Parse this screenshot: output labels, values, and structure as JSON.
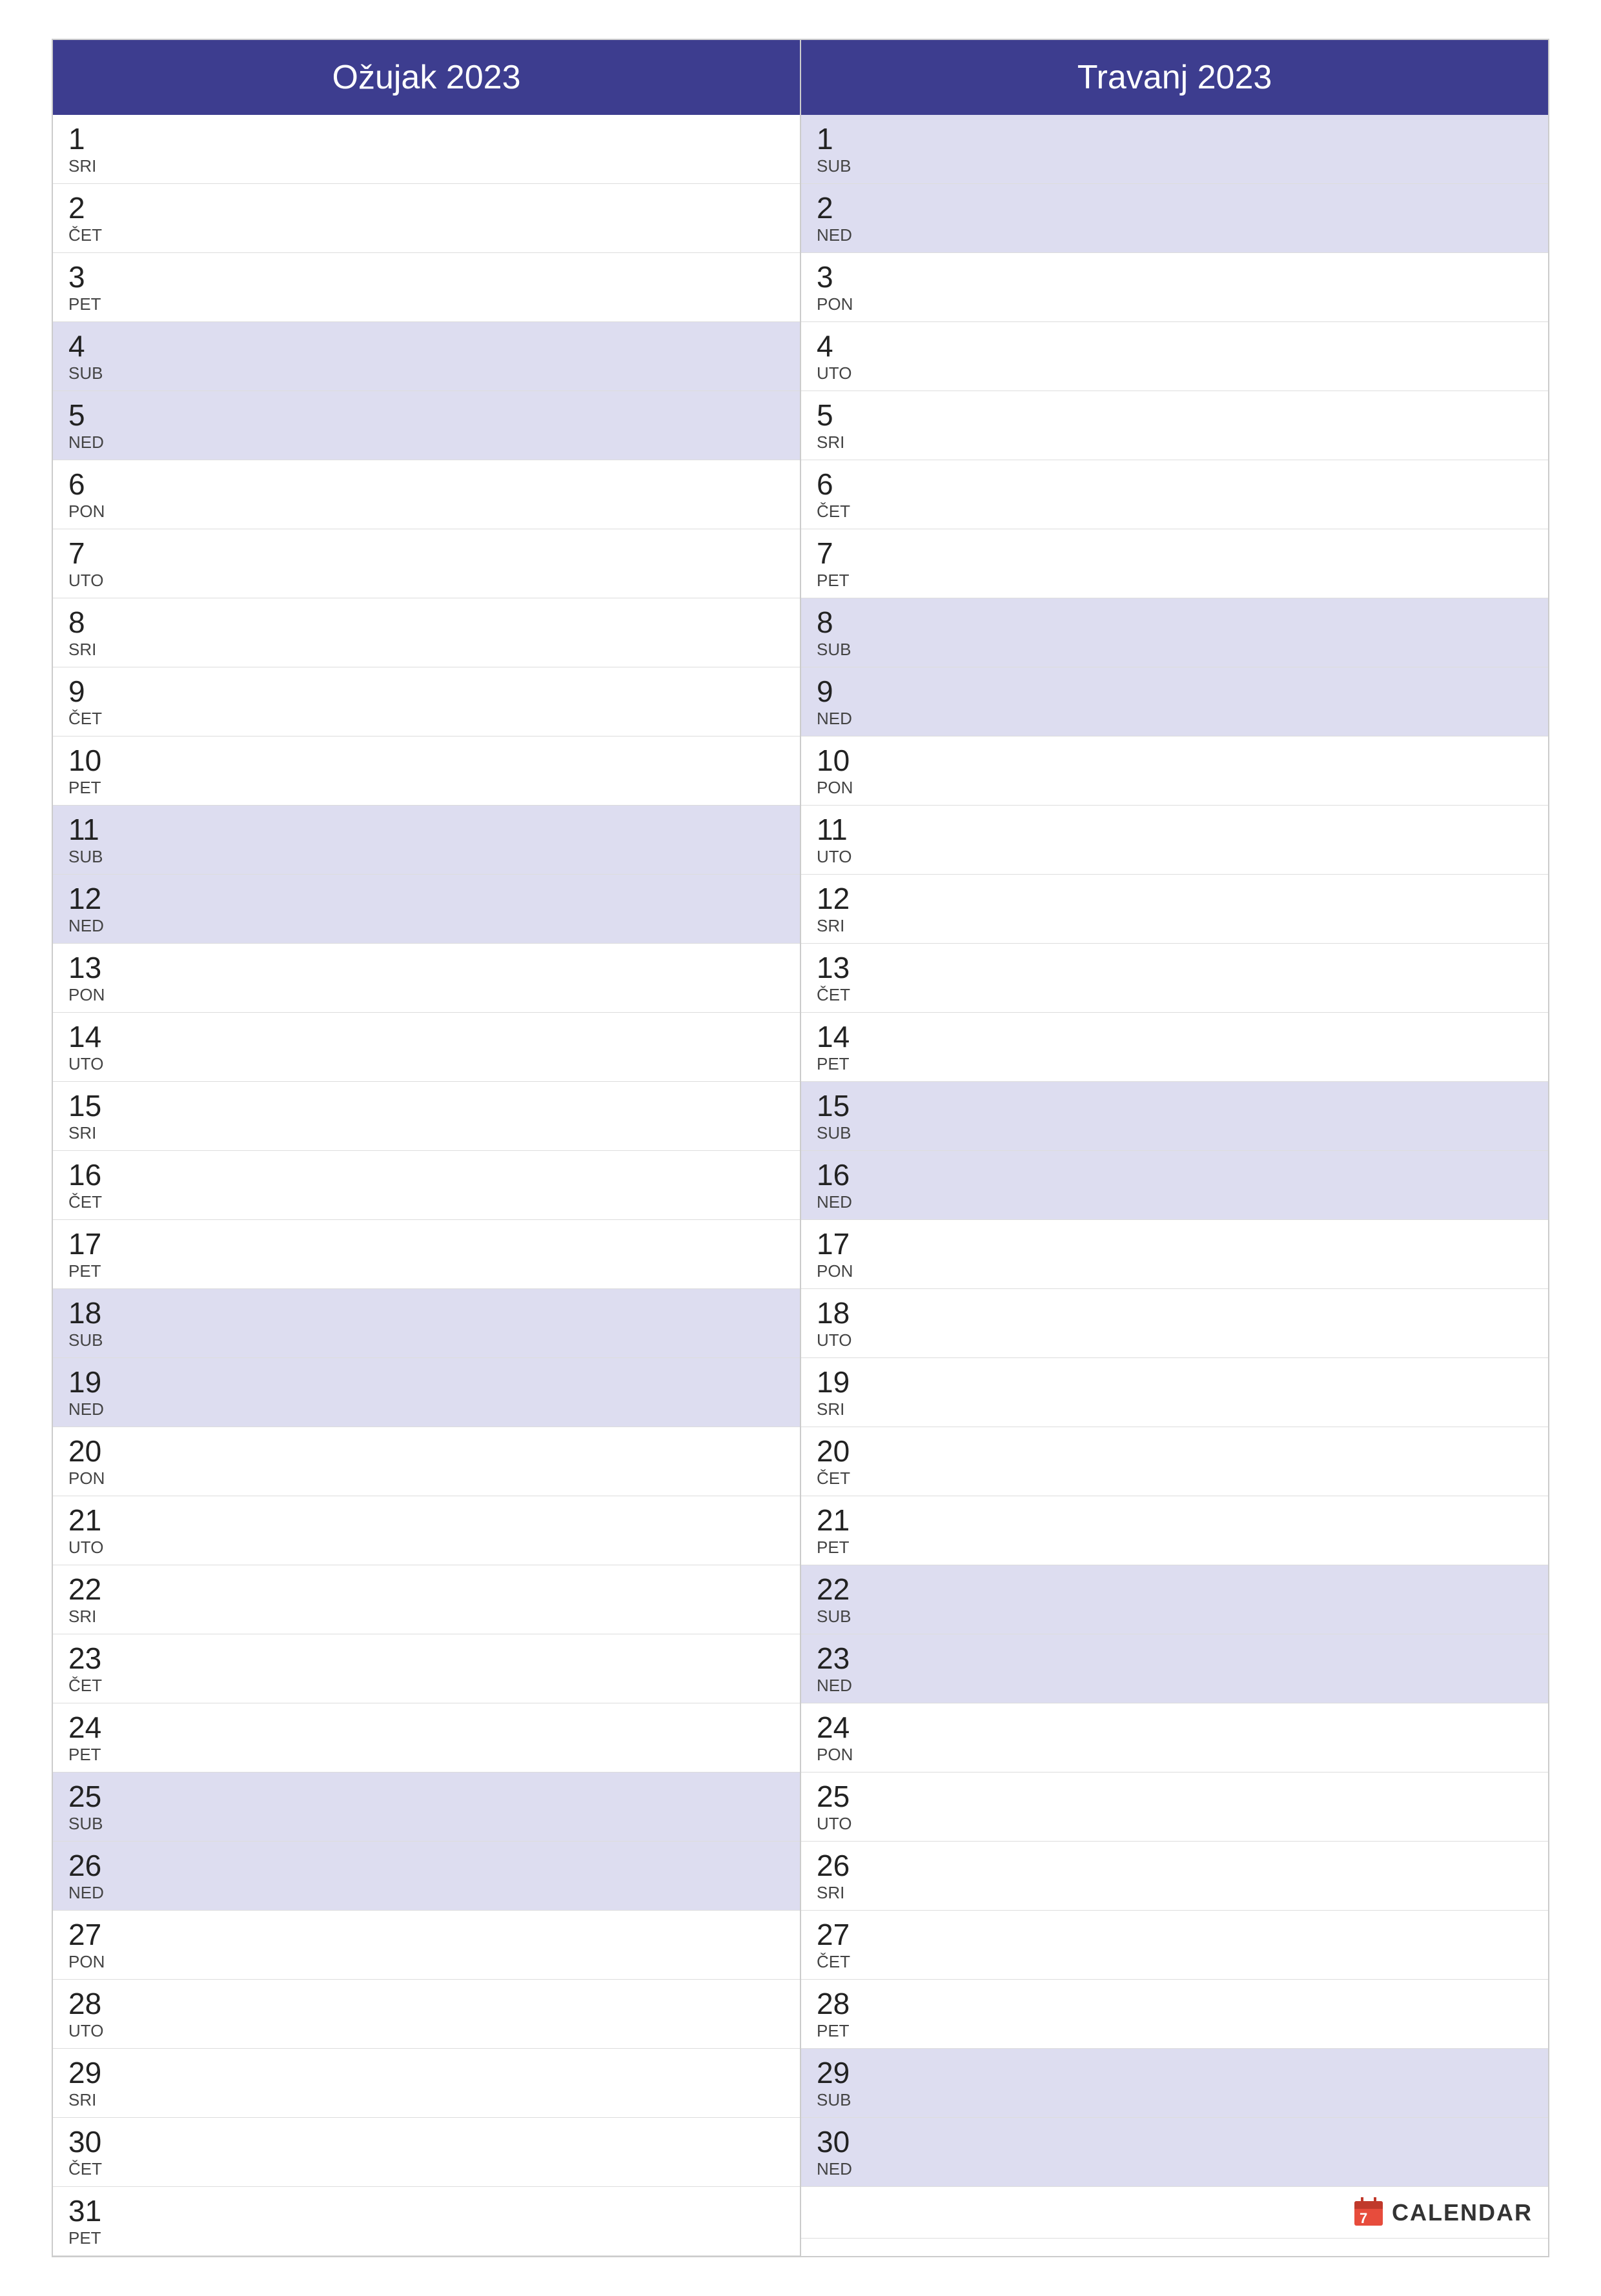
{
  "months": [
    {
      "name": "Ožujak 2023",
      "days": [
        {
          "num": "1",
          "name": "SRI",
          "weekend": false
        },
        {
          "num": "2",
          "name": "ČET",
          "weekend": false
        },
        {
          "num": "3",
          "name": "PET",
          "weekend": false
        },
        {
          "num": "4",
          "name": "SUB",
          "weekend": true
        },
        {
          "num": "5",
          "name": "NED",
          "weekend": true
        },
        {
          "num": "6",
          "name": "PON",
          "weekend": false
        },
        {
          "num": "7",
          "name": "UTO",
          "weekend": false
        },
        {
          "num": "8",
          "name": "SRI",
          "weekend": false
        },
        {
          "num": "9",
          "name": "ČET",
          "weekend": false
        },
        {
          "num": "10",
          "name": "PET",
          "weekend": false
        },
        {
          "num": "11",
          "name": "SUB",
          "weekend": true
        },
        {
          "num": "12",
          "name": "NED",
          "weekend": true
        },
        {
          "num": "13",
          "name": "PON",
          "weekend": false
        },
        {
          "num": "14",
          "name": "UTO",
          "weekend": false
        },
        {
          "num": "15",
          "name": "SRI",
          "weekend": false
        },
        {
          "num": "16",
          "name": "ČET",
          "weekend": false
        },
        {
          "num": "17",
          "name": "PET",
          "weekend": false
        },
        {
          "num": "18",
          "name": "SUB",
          "weekend": true
        },
        {
          "num": "19",
          "name": "NED",
          "weekend": true
        },
        {
          "num": "20",
          "name": "PON",
          "weekend": false
        },
        {
          "num": "21",
          "name": "UTO",
          "weekend": false
        },
        {
          "num": "22",
          "name": "SRI",
          "weekend": false
        },
        {
          "num": "23",
          "name": "ČET",
          "weekend": false
        },
        {
          "num": "24",
          "name": "PET",
          "weekend": false
        },
        {
          "num": "25",
          "name": "SUB",
          "weekend": true
        },
        {
          "num": "26",
          "name": "NED",
          "weekend": true
        },
        {
          "num": "27",
          "name": "PON",
          "weekend": false
        },
        {
          "num": "28",
          "name": "UTO",
          "weekend": false
        },
        {
          "num": "29",
          "name": "SRI",
          "weekend": false
        },
        {
          "num": "30",
          "name": "ČET",
          "weekend": false
        },
        {
          "num": "31",
          "name": "PET",
          "weekend": false
        }
      ]
    },
    {
      "name": "Travanj 2023",
      "days": [
        {
          "num": "1",
          "name": "SUB",
          "weekend": true
        },
        {
          "num": "2",
          "name": "NED",
          "weekend": true
        },
        {
          "num": "3",
          "name": "PON",
          "weekend": false
        },
        {
          "num": "4",
          "name": "UTO",
          "weekend": false
        },
        {
          "num": "5",
          "name": "SRI",
          "weekend": false
        },
        {
          "num": "6",
          "name": "ČET",
          "weekend": false
        },
        {
          "num": "7",
          "name": "PET",
          "weekend": false
        },
        {
          "num": "8",
          "name": "SUB",
          "weekend": true
        },
        {
          "num": "9",
          "name": "NED",
          "weekend": true
        },
        {
          "num": "10",
          "name": "PON",
          "weekend": false
        },
        {
          "num": "11",
          "name": "UTO",
          "weekend": false
        },
        {
          "num": "12",
          "name": "SRI",
          "weekend": false
        },
        {
          "num": "13",
          "name": "ČET",
          "weekend": false
        },
        {
          "num": "14",
          "name": "PET",
          "weekend": false
        },
        {
          "num": "15",
          "name": "SUB",
          "weekend": true
        },
        {
          "num": "16",
          "name": "NED",
          "weekend": true
        },
        {
          "num": "17",
          "name": "PON",
          "weekend": false
        },
        {
          "num": "18",
          "name": "UTO",
          "weekend": false
        },
        {
          "num": "19",
          "name": "SRI",
          "weekend": false
        },
        {
          "num": "20",
          "name": "ČET",
          "weekend": false
        },
        {
          "num": "21",
          "name": "PET",
          "weekend": false
        },
        {
          "num": "22",
          "name": "SUB",
          "weekend": true
        },
        {
          "num": "23",
          "name": "NED",
          "weekend": true
        },
        {
          "num": "24",
          "name": "PON",
          "weekend": false
        },
        {
          "num": "25",
          "name": "UTO",
          "weekend": false
        },
        {
          "num": "26",
          "name": "SRI",
          "weekend": false
        },
        {
          "num": "27",
          "name": "ČET",
          "weekend": false
        },
        {
          "num": "28",
          "name": "PET",
          "weekend": false
        },
        {
          "num": "29",
          "name": "SUB",
          "weekend": true
        },
        {
          "num": "30",
          "name": "NED",
          "weekend": true
        }
      ]
    }
  ],
  "brand": {
    "text": "CALENDAR"
  }
}
